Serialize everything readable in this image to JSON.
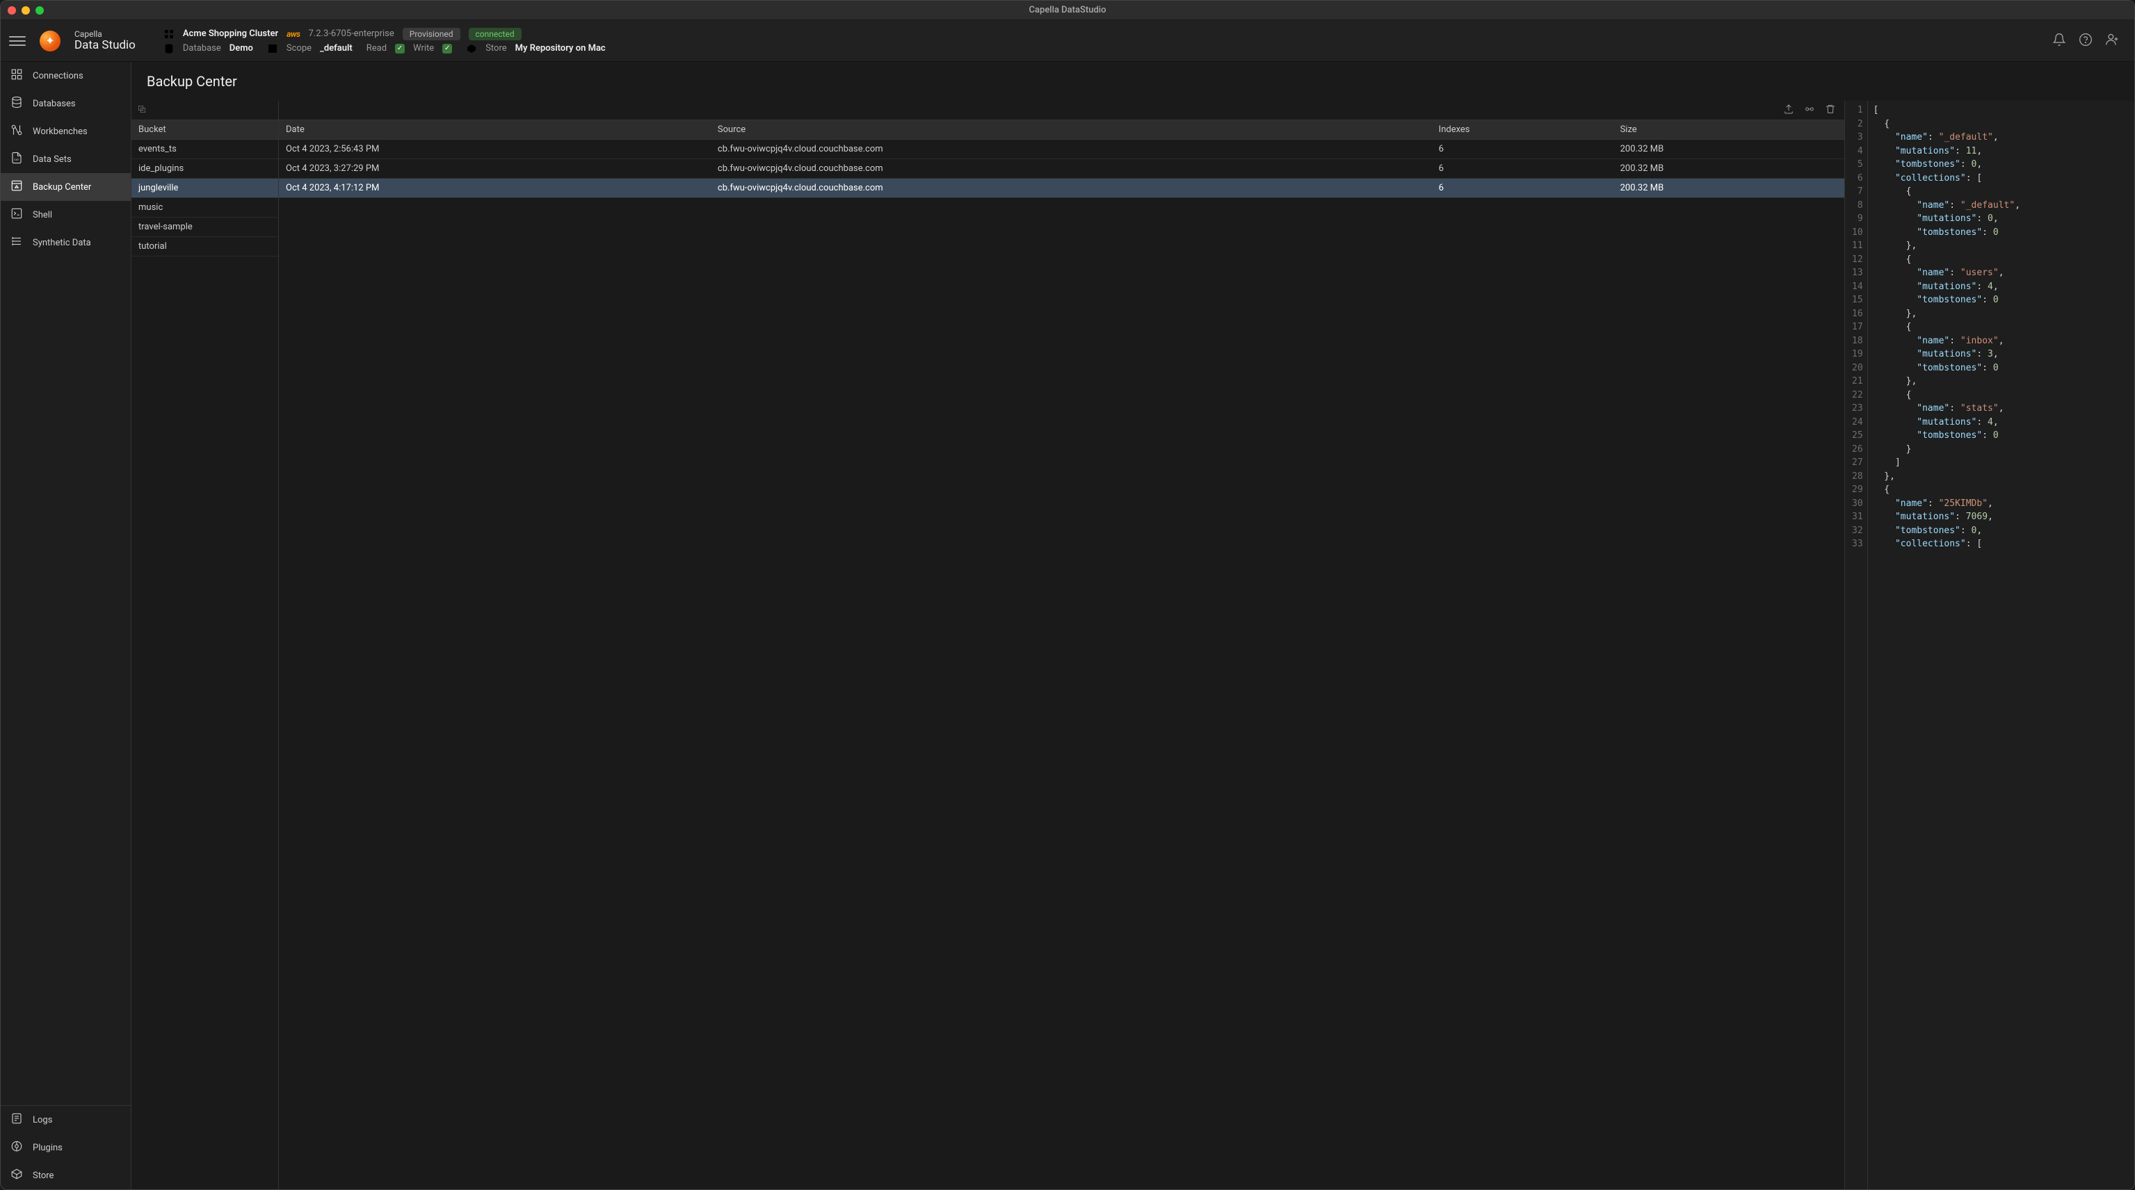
{
  "window": {
    "title": "Capella DataStudio"
  },
  "brand": {
    "line1": "Capella",
    "line2": "Data Studio"
  },
  "header": {
    "cluster_name": "Acme Shopping Cluster",
    "cloud_provider": "aws",
    "version": "7.2.3-6705-enterprise",
    "provisioned_label": "Provisioned",
    "connected_label": "connected",
    "database_label": "Database",
    "database_value": "Demo",
    "scope_label": "Scope",
    "scope_value": "_default",
    "read_label": "Read",
    "write_label": "Write",
    "store_label": "Store",
    "store_value": "My Repository on Mac"
  },
  "sidebar": {
    "items": [
      {
        "label": "Connections"
      },
      {
        "label": "Databases"
      },
      {
        "label": "Workbenches"
      },
      {
        "label": "Data Sets"
      },
      {
        "label": "Backup Center"
      },
      {
        "label": "Shell"
      },
      {
        "label": "Synthetic Data"
      }
    ],
    "bottom": [
      {
        "label": "Logs"
      },
      {
        "label": "Plugins"
      },
      {
        "label": "Store"
      }
    ]
  },
  "page": {
    "title": "Backup Center"
  },
  "buckets": {
    "header": "Bucket",
    "items": [
      {
        "name": "events_ts"
      },
      {
        "name": "ide_plugins"
      },
      {
        "name": "jungleville"
      },
      {
        "name": "music"
      },
      {
        "name": "travel-sample"
      },
      {
        "name": "tutorial"
      }
    ],
    "selected_index": 2
  },
  "backup_table": {
    "columns": [
      "Date",
      "Source",
      "Indexes",
      "Size"
    ],
    "rows": [
      {
        "date": "Oct 4 2023, 2:56:43 PM",
        "source": "cb.fwu-oviwcpjq4v.cloud.couchbase.com",
        "indexes": "6",
        "size": "200.32 MB"
      },
      {
        "date": "Oct 4 2023, 3:27:29 PM",
        "source": "cb.fwu-oviwcpjq4v.cloud.couchbase.com",
        "indexes": "6",
        "size": "200.32 MB"
      },
      {
        "date": "Oct 4 2023, 4:17:12 PM",
        "source": "cb.fwu-oviwcpjq4v.cloud.couchbase.com",
        "indexes": "6",
        "size": "200.32 MB"
      }
    ],
    "selected_index": 2
  },
  "code": {
    "lines": [
      [
        [
          "pun",
          "["
        ]
      ],
      [
        [
          "pun",
          "  {"
        ]
      ],
      [
        [
          "pun",
          "    "
        ],
        [
          "key",
          "\"name\""
        ],
        [
          "pun",
          ": "
        ],
        [
          "str",
          "\"_default\""
        ],
        [
          "pun",
          ","
        ]
      ],
      [
        [
          "pun",
          "    "
        ],
        [
          "key",
          "\"mutations\""
        ],
        [
          "pun",
          ": "
        ],
        [
          "num",
          "11"
        ],
        [
          "pun",
          ","
        ]
      ],
      [
        [
          "pun",
          "    "
        ],
        [
          "key",
          "\"tombstones\""
        ],
        [
          "pun",
          ": "
        ],
        [
          "num",
          "0"
        ],
        [
          "pun",
          ","
        ]
      ],
      [
        [
          "pun",
          "    "
        ],
        [
          "key",
          "\"collections\""
        ],
        [
          "pun",
          ": ["
        ]
      ],
      [
        [
          "pun",
          "      {"
        ]
      ],
      [
        [
          "pun",
          "        "
        ],
        [
          "key",
          "\"name\""
        ],
        [
          "pun",
          ": "
        ],
        [
          "str",
          "\"_default\""
        ],
        [
          "pun",
          ","
        ]
      ],
      [
        [
          "pun",
          "        "
        ],
        [
          "key",
          "\"mutations\""
        ],
        [
          "pun",
          ": "
        ],
        [
          "num",
          "0"
        ],
        [
          "pun",
          ","
        ]
      ],
      [
        [
          "pun",
          "        "
        ],
        [
          "key",
          "\"tombstones\""
        ],
        [
          "pun",
          ": "
        ],
        [
          "num",
          "0"
        ]
      ],
      [
        [
          "pun",
          "      },"
        ]
      ],
      [
        [
          "pun",
          "      {"
        ]
      ],
      [
        [
          "pun",
          "        "
        ],
        [
          "key",
          "\"name\""
        ],
        [
          "pun",
          ": "
        ],
        [
          "str",
          "\"users\""
        ],
        [
          "pun",
          ","
        ]
      ],
      [
        [
          "pun",
          "        "
        ],
        [
          "key",
          "\"mutations\""
        ],
        [
          "pun",
          ": "
        ],
        [
          "num",
          "4"
        ],
        [
          "pun",
          ","
        ]
      ],
      [
        [
          "pun",
          "        "
        ],
        [
          "key",
          "\"tombstones\""
        ],
        [
          "pun",
          ": "
        ],
        [
          "num",
          "0"
        ]
      ],
      [
        [
          "pun",
          "      },"
        ]
      ],
      [
        [
          "pun",
          "      {"
        ]
      ],
      [
        [
          "pun",
          "        "
        ],
        [
          "key",
          "\"name\""
        ],
        [
          "pun",
          ": "
        ],
        [
          "str",
          "\"inbox\""
        ],
        [
          "pun",
          ","
        ]
      ],
      [
        [
          "pun",
          "        "
        ],
        [
          "key",
          "\"mutations\""
        ],
        [
          "pun",
          ": "
        ],
        [
          "num",
          "3"
        ],
        [
          "pun",
          ","
        ]
      ],
      [
        [
          "pun",
          "        "
        ],
        [
          "key",
          "\"tombstones\""
        ],
        [
          "pun",
          ": "
        ],
        [
          "num",
          "0"
        ]
      ],
      [
        [
          "pun",
          "      },"
        ]
      ],
      [
        [
          "pun",
          "      {"
        ]
      ],
      [
        [
          "pun",
          "        "
        ],
        [
          "key",
          "\"name\""
        ],
        [
          "pun",
          ": "
        ],
        [
          "str",
          "\"stats\""
        ],
        [
          "pun",
          ","
        ]
      ],
      [
        [
          "pun",
          "        "
        ],
        [
          "key",
          "\"mutations\""
        ],
        [
          "pun",
          ": "
        ],
        [
          "num",
          "4"
        ],
        [
          "pun",
          ","
        ]
      ],
      [
        [
          "pun",
          "        "
        ],
        [
          "key",
          "\"tombstones\""
        ],
        [
          "pun",
          ": "
        ],
        [
          "num",
          "0"
        ]
      ],
      [
        [
          "pun",
          "      }"
        ]
      ],
      [
        [
          "pun",
          "    ]"
        ]
      ],
      [
        [
          "pun",
          "  },"
        ]
      ],
      [
        [
          "pun",
          "  {"
        ]
      ],
      [
        [
          "pun",
          "    "
        ],
        [
          "key",
          "\"name\""
        ],
        [
          "pun",
          ": "
        ],
        [
          "str",
          "\"25KIMDb\""
        ],
        [
          "pun",
          ","
        ]
      ],
      [
        [
          "pun",
          "    "
        ],
        [
          "key",
          "\"mutations\""
        ],
        [
          "pun",
          ": "
        ],
        [
          "num",
          "7069"
        ],
        [
          "pun",
          ","
        ]
      ],
      [
        [
          "pun",
          "    "
        ],
        [
          "key",
          "\"tombstones\""
        ],
        [
          "pun",
          ": "
        ],
        [
          "num",
          "0"
        ],
        [
          "pun",
          ","
        ]
      ],
      [
        [
          "pun",
          "    "
        ],
        [
          "key",
          "\"collections\""
        ],
        [
          "pun",
          ": ["
        ]
      ]
    ]
  }
}
